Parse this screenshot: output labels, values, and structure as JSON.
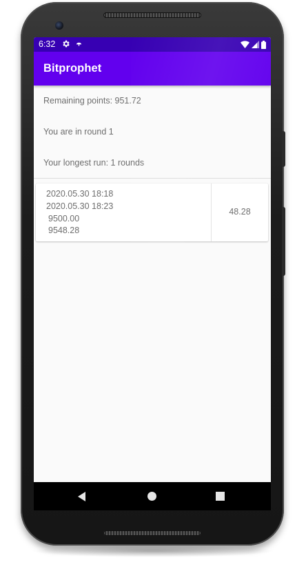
{
  "status_bar": {
    "time": "6:32",
    "icons": [
      "gear-icon",
      "notification-dot-icon",
      "wifi-icon",
      "cell-signal-icon",
      "battery-icon"
    ]
  },
  "app_bar": {
    "title": "Bitprophet"
  },
  "summary": {
    "remaining_points": "Remaining points: 951.72",
    "round": "You are in round 1",
    "longest_run": "Your longest run: 1 rounds"
  },
  "entries": [
    {
      "start_time": "2020.05.30 18:18",
      "end_time": "2020.05.30 18:23",
      "start_value": "9500.00",
      "end_value": "9548.28",
      "result": "48.28"
    }
  ],
  "colors": {
    "status_bar": "#3700b3",
    "app_bar": "#6200ee",
    "background": "#fafafa",
    "text": "#6d6d6d"
  },
  "nav_bar": {
    "icons": [
      "back-icon",
      "home-icon",
      "recents-icon"
    ]
  }
}
